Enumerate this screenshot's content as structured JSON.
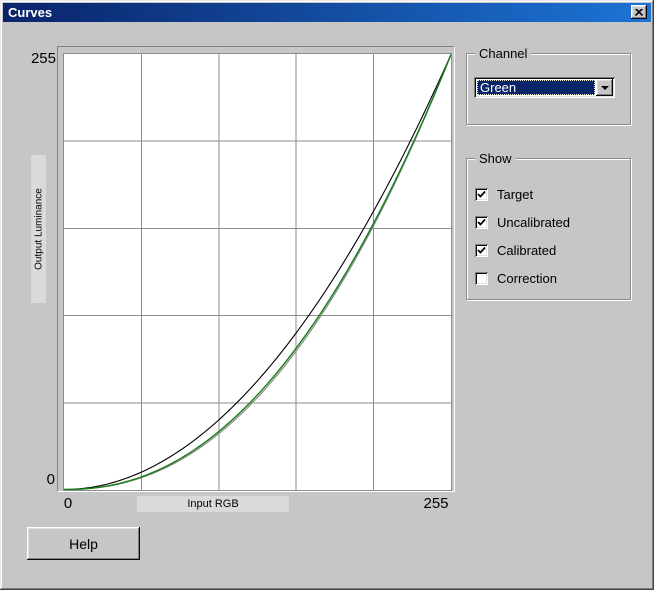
{
  "window": {
    "title": "Curves"
  },
  "colors": {
    "dialog_bg": "#c6c6c6",
    "titlebar_left": "#0a246a",
    "titlebar_right": "#1c74d6",
    "selection_bg": "#0a246a",
    "selection_text": "#ffffff",
    "plot_bg": "#ffffff",
    "gridline": "#8c8c8c",
    "curve_uncalibrated": "#000000",
    "curve_calibrated": "#177d17",
    "curve_target": "#8a8a8a"
  },
  "chart": {
    "y_max_label": "255",
    "y_min_label": "0",
    "x_min_label": "0",
    "x_max_label": "255",
    "x_axis_label": "Input RGB",
    "y_axis_label": "Output Luminance"
  },
  "chart_data": {
    "type": "line",
    "title": "",
    "xlabel": "Input RGB",
    "ylabel": "Output Luminance",
    "xlim": [
      0,
      255
    ],
    "ylim": [
      0,
      255
    ],
    "x_ticks": [
      0,
      255
    ],
    "y_ticks": [
      0,
      255
    ],
    "grid": true,
    "grid_divisions": 5,
    "legend_position": "none",
    "x_samples": [
      0,
      32,
      64,
      96,
      128,
      160,
      192,
      224,
      255
    ],
    "series": [
      {
        "name": "Target",
        "color": "#8a8a8a",
        "gamma": 2.24,
        "stroke_width": 1.2,
        "values": [
          0,
          2.4,
          11.5,
          28.6,
          54.0,
          89.8,
          135.0,
          190.7,
          255
        ]
      },
      {
        "name": "Uncalibrated",
        "color": "#000000",
        "gamma": 2.0,
        "stroke_width": 1.1,
        "values": [
          0,
          4.0,
          16.0,
          36.1,
          64.3,
          100.4,
          144.6,
          196.8,
          255
        ]
      },
      {
        "name": "Calibrated",
        "color": "#177d17",
        "gamma": 2.2,
        "stroke_width": 1.4,
        "values": [
          0,
          2.7,
          12.2,
          29.7,
          55.5,
          91.5,
          136.6,
          191.7,
          255
        ]
      }
    ]
  },
  "channel": {
    "label": "Channel",
    "selected_option": "Green"
  },
  "show": {
    "label": "Show",
    "items": [
      {
        "label": "Target",
        "checked": true
      },
      {
        "label": "Uncalibrated",
        "checked": true
      },
      {
        "label": "Calibrated",
        "checked": true
      },
      {
        "label": "Correction",
        "checked": false
      }
    ]
  },
  "help_button": {
    "label": "Help"
  }
}
